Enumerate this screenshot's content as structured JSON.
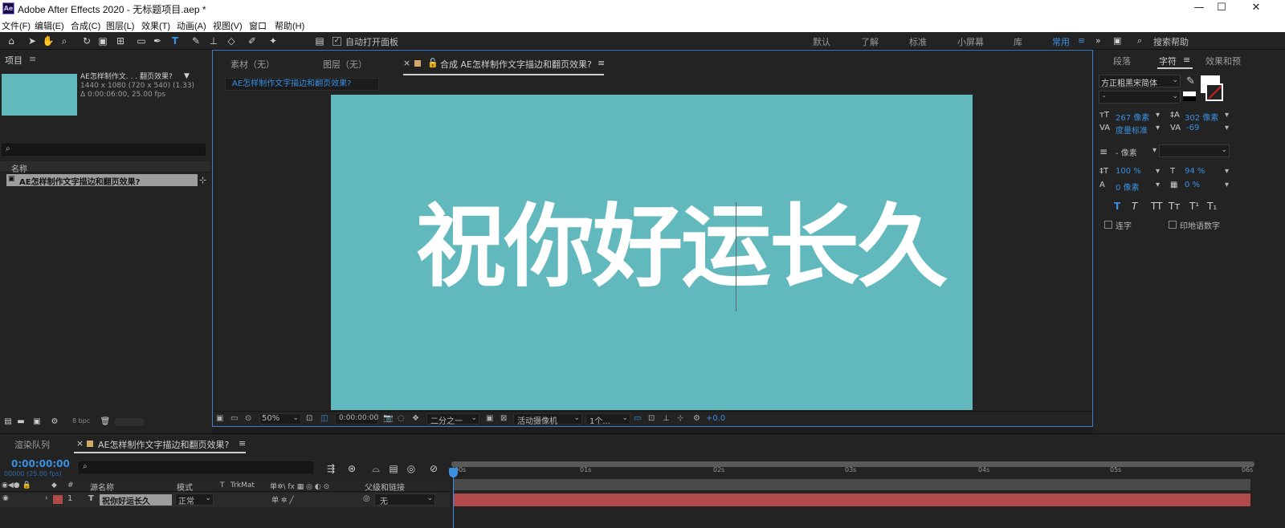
{
  "app": {
    "title": "Adobe After Effects 2020 - 无标题项目.aep *",
    "logo": "Ae",
    "window_controls": [
      "—",
      "☐",
      "✕"
    ]
  },
  "menu": [
    "文件(F)",
    "编辑(E)",
    "合成(C)",
    "图层(L)",
    "效果(T)",
    "动画(A)",
    "视图(V)",
    "窗口",
    "帮助(H)"
  ],
  "toolbar": {
    "auto_open_label": "自动打开面板",
    "workspaces": [
      "默认",
      "了解",
      "标准",
      "小屏幕",
      "库",
      "常用"
    ],
    "active_workspace": "常用",
    "search_help": "搜索帮助"
  },
  "project": {
    "panel_title": "项目",
    "item_name_short": "AE怎样制作文. . . 翻页效果?",
    "meta_line1": "1440 x 1080  (720 x 540) (1.33)",
    "meta_line2": "Δ 0:00:06:00, 25.00 fps",
    "column_name": "名称",
    "item_name": "AE怎样制作文字描边和翻页效果?",
    "bpc": "8 bpc",
    "thumb_color": "#62b9bd"
  },
  "viewer": {
    "tabs": [
      "素材（无）",
      "图层（无）",
      "合成 AE怎样制作文字描边和翻页效果?"
    ],
    "breadcrumb": "AE怎样制作文字描边和翻页效果?",
    "comp_text": "祝你好运长久",
    "bg_color": "#62b9bd",
    "zoom": "50%",
    "timecode": "0:00:00:00",
    "resolution": "二分之一",
    "camera": "活动摄像机",
    "views": "1个...",
    "exposure": "+0.0"
  },
  "right_panel": {
    "tabs": [
      "段落",
      "字符",
      "效果和预"
    ],
    "active_tab": "字符",
    "font": "方正粗黑宋简体",
    "font_style": "-",
    "size": "267 像素",
    "leading": "302 像素",
    "kerning": "度量标准",
    "tracking": "-69",
    "stroke": "- 像素",
    "vscale": "100 %",
    "hscale": "94 %",
    "baseline": "0 像素",
    "tsume": "0 %",
    "ligatures": "连字",
    "hindi_digits": "印地语数字",
    "style_buttons": [
      "T",
      "T",
      "TT",
      "Tт",
      "T¹",
      "T₁"
    ]
  },
  "timeline": {
    "tabs": [
      "渲染队列",
      "AE怎样制作文字描边和翻页效果?"
    ],
    "time": "0:00:00:00",
    "fps": "00000 (25.00 fps)",
    "columns": {
      "source_name": "源名称",
      "mode": "模式",
      "t": "T",
      "trkmat": "TrkMat",
      "switches": "单✲\\ fx ▦ ◎ ◐ ⊙",
      "parent": "父级和链接"
    },
    "layer": {
      "index": "1",
      "type": "T",
      "name": "祝你好运长久",
      "mode": "正常",
      "parent": "无",
      "color": "#b14a4a"
    },
    "ruler_ticks": [
      "00s",
      "01s",
      "02s",
      "03s",
      "04s",
      "05s",
      "06s"
    ]
  }
}
